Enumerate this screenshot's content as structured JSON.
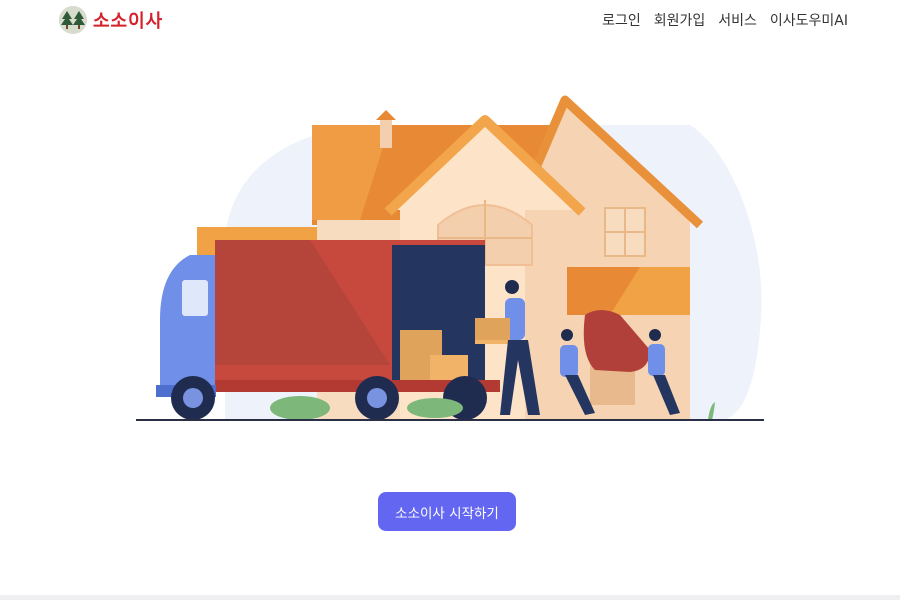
{
  "brand": {
    "name": "소소이사",
    "accent": "#d6202a"
  },
  "nav": {
    "items": [
      {
        "label": "로그인"
      },
      {
        "label": "회원가입"
      },
      {
        "label": "서비스"
      },
      {
        "label": "이사도우미AI"
      }
    ]
  },
  "hero": {
    "cta_label": "소소이사 시작하기",
    "cta_color": "#6366f1"
  },
  "colors": {
    "roof": "#e8913a",
    "house": "#f6d8b8",
    "truck_box": "#c7483d",
    "truck_cab": "#6f8fe8",
    "backdrop": "#eef2fb"
  },
  "icons": {
    "logo": "tree-logo-icon"
  }
}
